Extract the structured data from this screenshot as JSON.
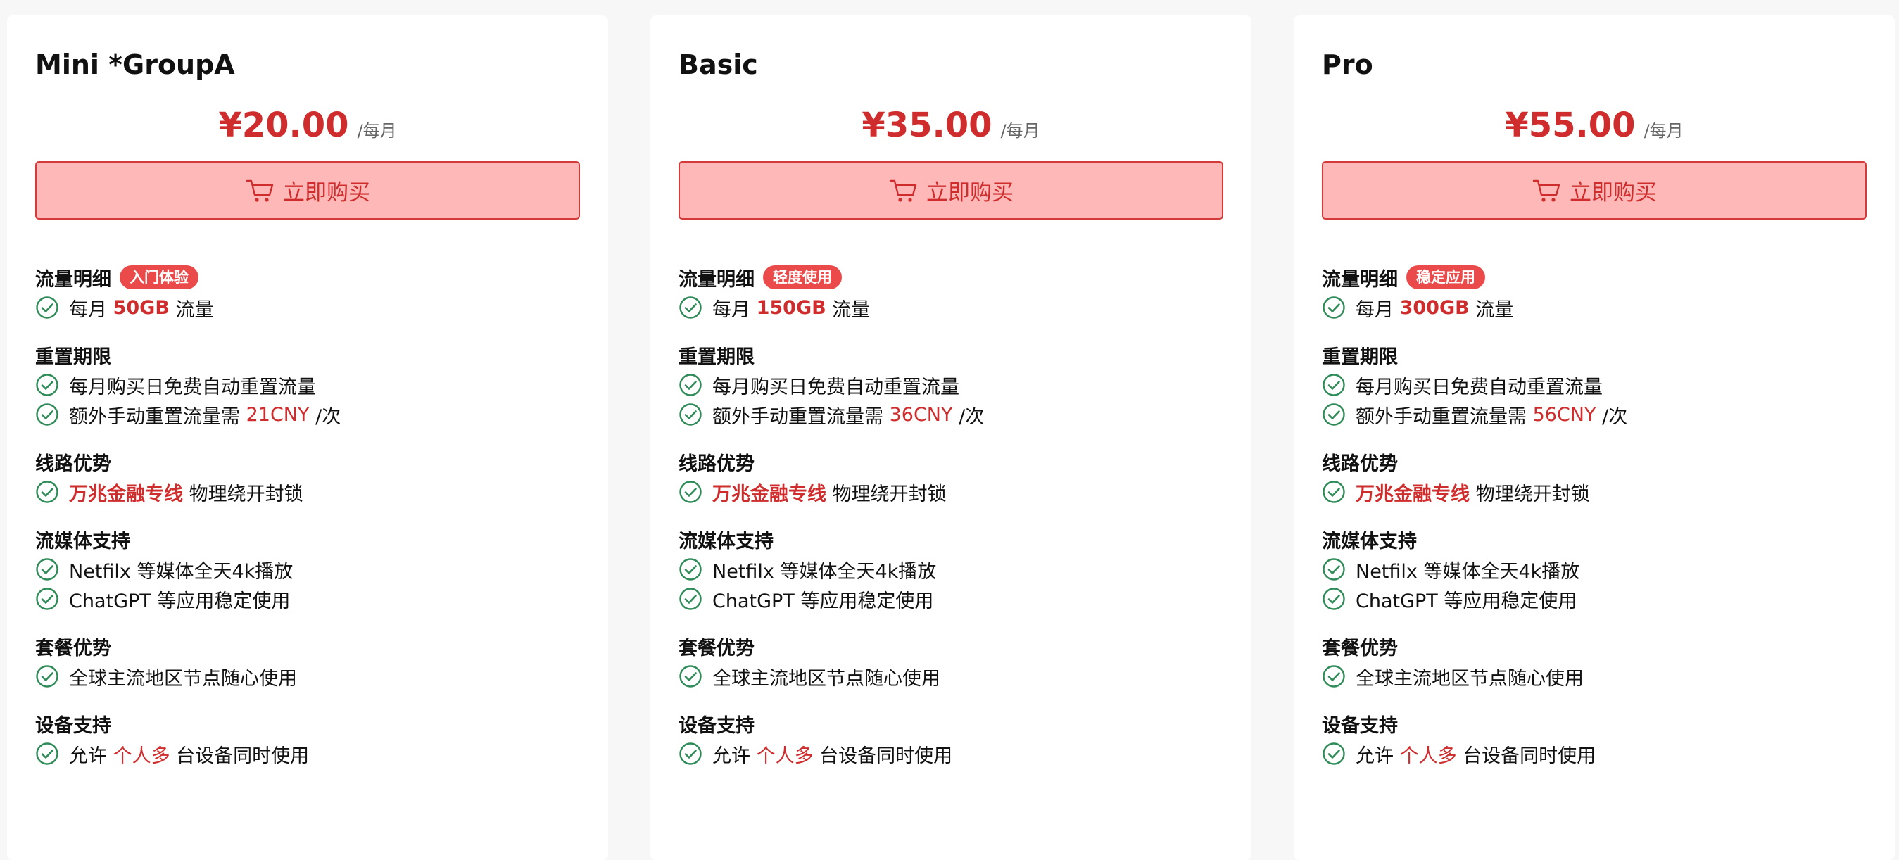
{
  "common": {
    "period": "/每月",
    "buy_label": "立即购买",
    "section_traffic": "流量明细",
    "section_reset": "重置期限",
    "section_route": "线路优势",
    "section_media": "流媒体支持",
    "section_plan": "套餐优势",
    "section_device": "设备支持",
    "traffic_prefix": "每月",
    "traffic_suffix": "流量",
    "reset_auto": "每月购买日免费自动重置流量",
    "reset_manual_prefix": "额外手动重置流量需",
    "reset_manual_suffix": "/次",
    "route_highlight": "万兆金融专线",
    "route_suffix": "物理绕开封锁",
    "media_netflix": "Netfilx 等媒体全天4k播放",
    "media_chatgpt": "ChatGPT 等应用稳定使用",
    "plan_global": "全球主流地区节点随心使用",
    "device_prefix": "允许",
    "device_highlight": "个人多",
    "device_suffix": "台设备同时使用"
  },
  "colors": {
    "accent": "#cf2d2d",
    "button_bg": "#ffb8b8",
    "tag_bg": "#ea4a4a",
    "check": "#2e8b57"
  },
  "icons": {
    "buy": "cart-icon",
    "feature": "check-circle-icon"
  },
  "plans": [
    {
      "name": "Mini *GroupA",
      "price": "¥20.00",
      "tag": "入门体验",
      "traffic": "50GB",
      "reset_price": "21CNY"
    },
    {
      "name": "Basic",
      "price": "¥35.00",
      "tag": "轻度使用",
      "traffic": "150GB",
      "reset_price": "36CNY"
    },
    {
      "name": "Pro",
      "price": "¥55.00",
      "tag": "稳定应用",
      "traffic": "300GB",
      "reset_price": "56CNY"
    }
  ]
}
